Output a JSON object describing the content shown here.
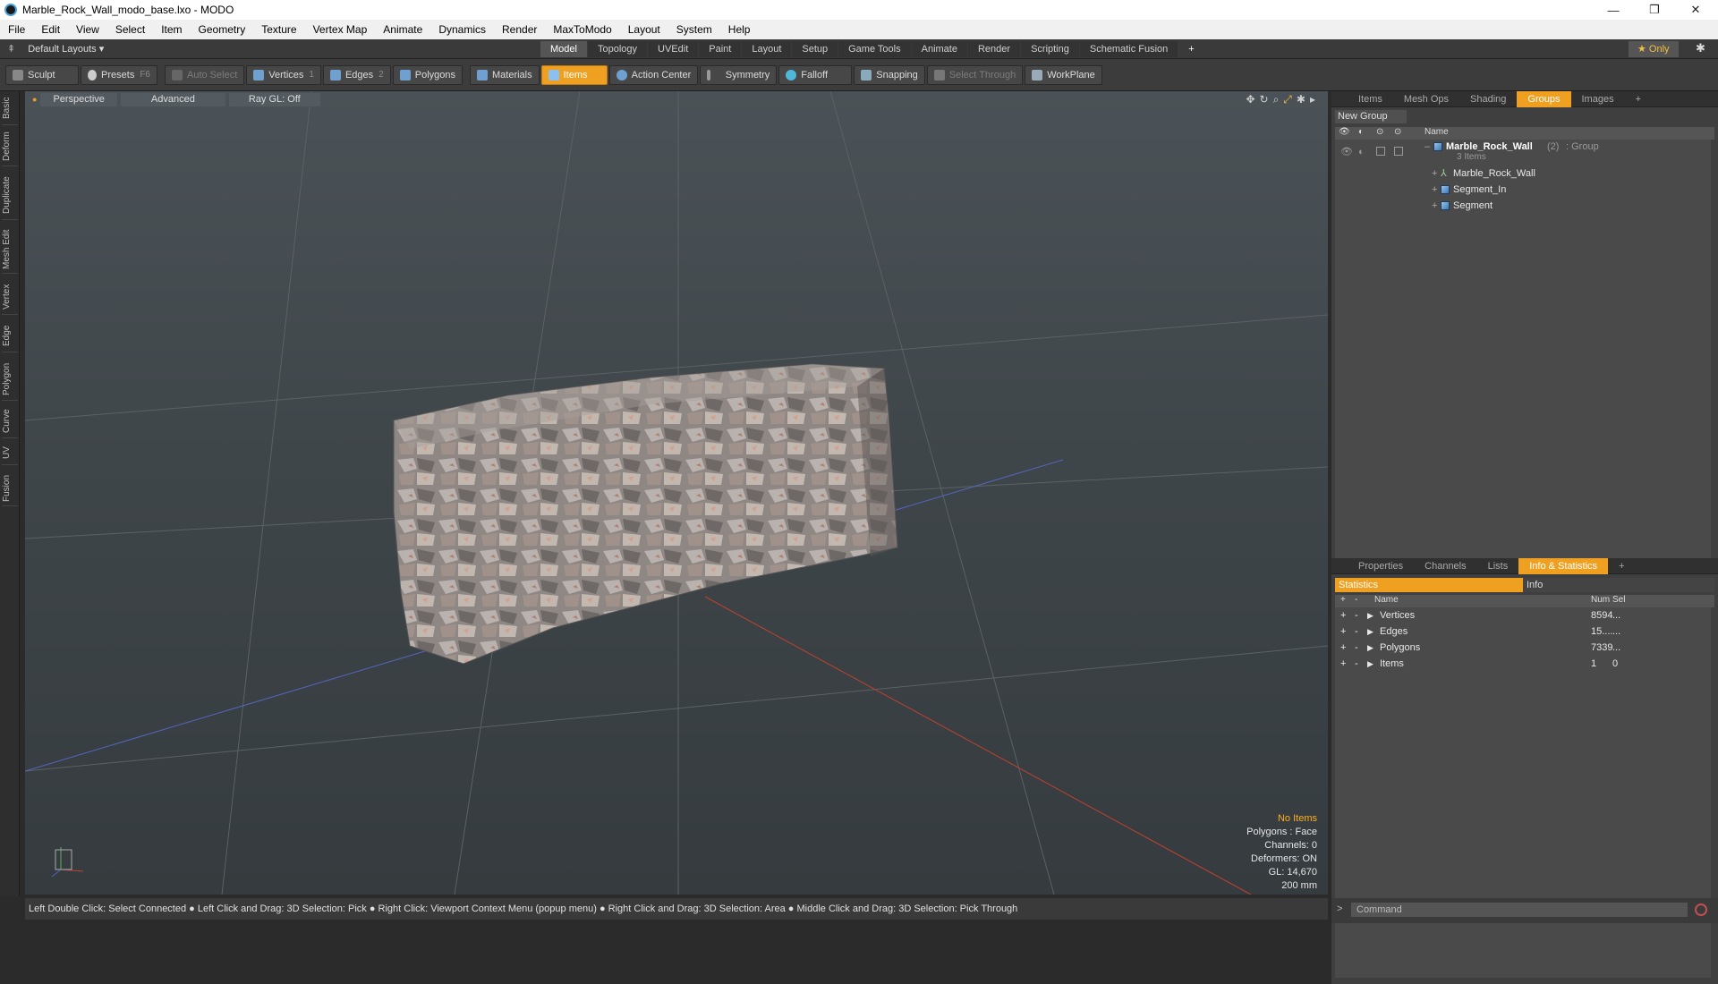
{
  "window": {
    "title": "Marble_Rock_Wall_modo_base.lxo - MODO"
  },
  "menu": [
    "File",
    "Edit",
    "View",
    "Select",
    "Item",
    "Geometry",
    "Texture",
    "Vertex Map",
    "Animate",
    "Dynamics",
    "Render",
    "MaxToModo",
    "Layout",
    "System",
    "Help"
  ],
  "layout": {
    "preset": "Default Layouts ▾",
    "tabs": [
      "Model",
      "Topology",
      "UVEdit",
      "Paint",
      "Layout",
      "Setup",
      "Game Tools",
      "Animate",
      "Render",
      "Scripting",
      "Schematic Fusion"
    ],
    "only": "★ Only"
  },
  "toolbar": {
    "sculpt": "Sculpt",
    "presets": "Presets",
    "presets_key": "F6",
    "auto_select": "Auto Select",
    "vertices": "Vertices",
    "vertices_key": "1",
    "edges": "Edges",
    "edges_key": "2",
    "polygons": "Polygons",
    "materials": "Materials",
    "items": "Items",
    "action_center": "Action Center",
    "symmetry": "Symmetry",
    "falloff": "Falloff",
    "snapping": "Snapping",
    "select_through": "Select Through",
    "workplane": "WorkPlane"
  },
  "left_tabs": [
    "Basic",
    "Deform",
    "Duplicate",
    "Mesh Edit",
    "Vertex",
    "Edge",
    "Polygon",
    "Curve",
    "UV",
    "Fusion"
  ],
  "viewport": {
    "perspective": "Perspective",
    "advanced": "Advanced",
    "raygl": "Ray GL: Off",
    "info": {
      "no_items": "No Items",
      "polygons": "Polygons : Face",
      "channels": "Channels: 0",
      "deformers": "Deformers: ON",
      "gl": "GL: 14,670",
      "scale": "200 mm"
    }
  },
  "status": "Left Double Click: Select Connected ● Left Click and Drag: 3D Selection: Pick ● Right Click: Viewport Context Menu (popup menu) ● Right Click and Drag: 3D Selection: Area ● Middle Click and Drag: 3D Selection: Pick Through",
  "groups_panel": {
    "tabs": [
      "Items",
      "Mesh Ops",
      "Shading",
      "Groups",
      "Images"
    ],
    "new_group": "New Group",
    "col_name": "Name",
    "group": {
      "name": "Marble_Rock_Wall",
      "count": "(2)",
      "type": ": Group",
      "sub": "3 Items"
    },
    "children": [
      "Marble_Rock_Wall",
      "Segment_In",
      "Segment"
    ]
  },
  "stats_panel": {
    "tabs": [
      "Properties",
      "Channels",
      "Lists",
      "Info & Statistics"
    ],
    "sub_tabs": [
      "Statistics",
      "Info"
    ],
    "cols": {
      "name": "Name",
      "num": "Num",
      "sel": "Sel"
    },
    "rows": [
      {
        "name": "Vertices",
        "num": "8594",
        "sel": "..."
      },
      {
        "name": "Edges",
        "num": "15....",
        "sel": "..."
      },
      {
        "name": "Polygons",
        "num": "7339",
        "sel": "..."
      },
      {
        "name": "Items",
        "num": "1",
        "sel": "0"
      }
    ]
  },
  "command": {
    "placeholder": "Command"
  }
}
